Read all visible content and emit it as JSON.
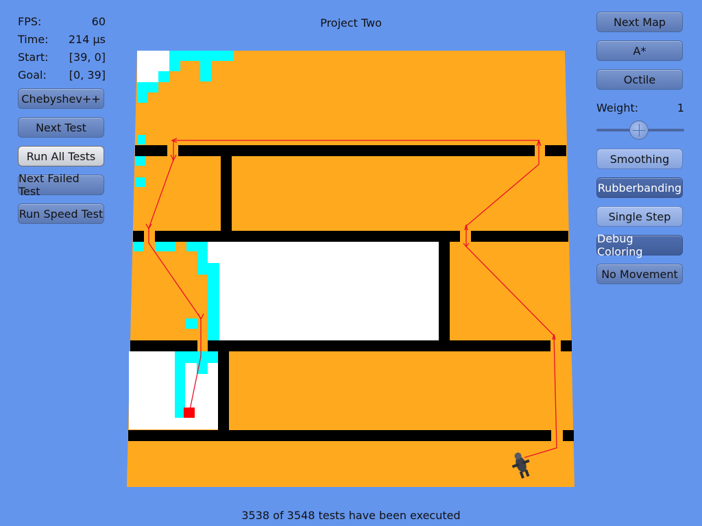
{
  "title": "Project Two",
  "stats": {
    "fps_label": "FPS:",
    "fps_value": "60",
    "time_label": "Time:",
    "time_value": "214 µs",
    "start_label": "Start:",
    "start_value": "[39, 0]",
    "goal_label": "Goal:",
    "goal_value": "[0, 39]"
  },
  "left_buttons": {
    "heuristic": "Chebyshev++",
    "next_test": "Next Test",
    "run_all": "Run All Tests",
    "next_failed": "Next Failed Test",
    "run_speed": "Run Speed Test"
  },
  "right_buttons": {
    "next_map": "Next Map",
    "algorithm": "A*",
    "heuristic_mode": "Octile",
    "smoothing": "Smoothing",
    "rubberbanding": "Rubberbanding",
    "single_step": "Single Step",
    "debug_coloring": "Debug Coloring",
    "no_movement": "No Movement"
  },
  "weight": {
    "label": "Weight:",
    "value": "1",
    "slider_value": 1
  },
  "footer": "3538 of 3548 tests have been executed",
  "colors": {
    "background": "#6495ed",
    "floor": "#ffa91f",
    "wall": "#000000",
    "open_list": "#00ffff",
    "unvisited": "#ffffff",
    "path": "#e8102a",
    "goal_marker": "#ff0000"
  }
}
